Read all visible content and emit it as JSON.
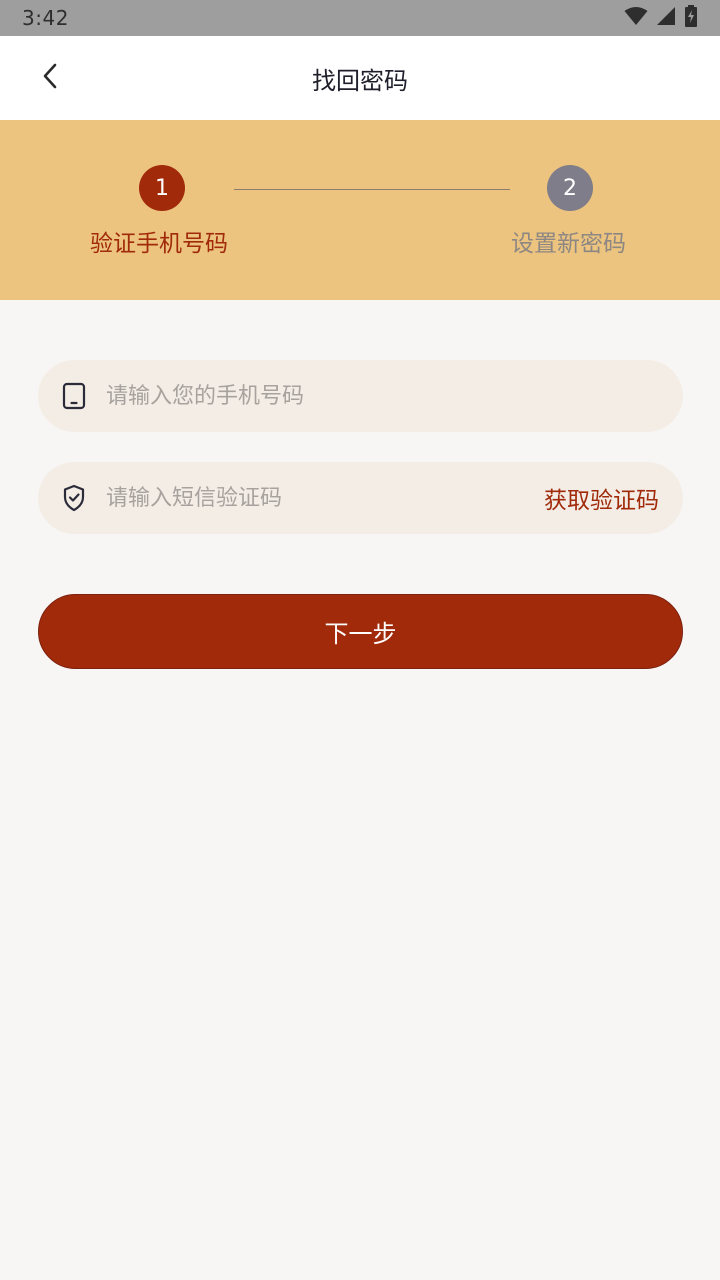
{
  "status_bar": {
    "time": "3:42",
    "icons": [
      "wifi-icon",
      "cellular-signal-icon",
      "battery-charging-icon"
    ]
  },
  "nav": {
    "title": "找回密码",
    "back_icon": "chevron-left-icon"
  },
  "steps": {
    "items": [
      {
        "number": "1",
        "label": "验证手机号码",
        "state": "active",
        "color": "#a02a0a"
      },
      {
        "number": "2",
        "label": "设置新密码",
        "state": "inactive",
        "color": "#7f7d89"
      }
    ],
    "banner_color": "#ecc47f"
  },
  "form": {
    "phone": {
      "icon": "phone-icon",
      "placeholder": "请输入您的手机号码",
      "value": ""
    },
    "code": {
      "icon": "shield-check-icon",
      "placeholder": "请输入短信验证码",
      "value": "",
      "get_code_label": "获取验证码"
    },
    "next_label": "下一步"
  },
  "colors": {
    "accent": "#a02a0a",
    "background": "#f7f6f4",
    "input_background": "#f3ede6"
  }
}
